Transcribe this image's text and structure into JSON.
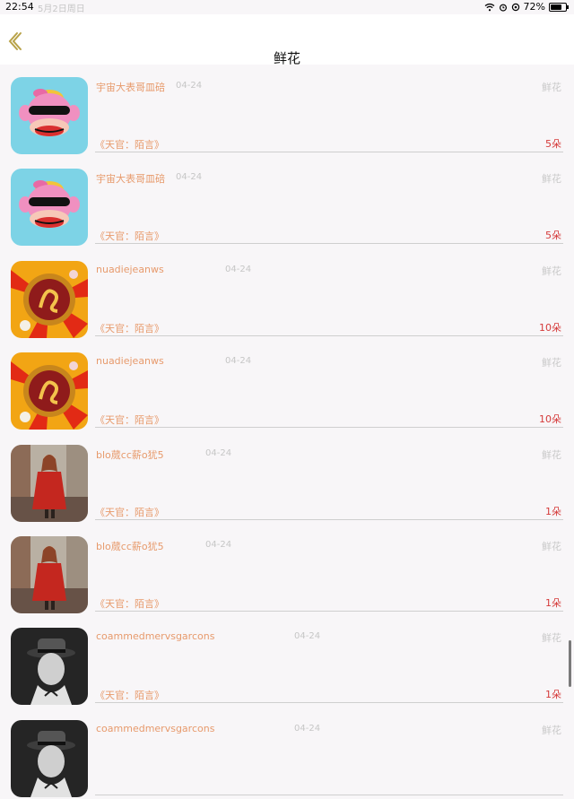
{
  "status_bar": {
    "time": "22:54",
    "date": "5月2日周日",
    "battery": "72%",
    "battery_level": 0.72
  },
  "nav": {
    "title": "鲜花",
    "back_icon": "chevron-left-icon"
  },
  "rows": [
    {
      "user": "宇宙大表哥皿碚",
      "date": "04-24",
      "type": "鲜花",
      "work": "《天官：陌言》",
      "qty": "5朵",
      "avatar": "monkey"
    },
    {
      "user": "宇宙大表哥皿碚",
      "date": "04-24",
      "type": "鲜花",
      "work": "《天官：陌言》",
      "qty": "5朵",
      "avatar": "monkey"
    },
    {
      "user": "nuadiejeanws",
      "date": "04-24",
      "type": "鲜花",
      "work": "《天官：陌言》",
      "qty": "10朵",
      "avatar": "medallion"
    },
    {
      "user": "nuadiejeanws",
      "date": "04-24",
      "type": "鲜花",
      "work": "《天官：陌言》",
      "qty": "10朵",
      "avatar": "medallion"
    },
    {
      "user": "blo蒇cc薪o犹5",
      "date": "04-24",
      "type": "鲜花",
      "work": "《天官：陌言》",
      "qty": "1朵",
      "avatar": "redcoat"
    },
    {
      "user": "blo蒇cc薪o犹5",
      "date": "04-24",
      "type": "鲜花",
      "work": "《天官：陌言》",
      "qty": "1朵",
      "avatar": "redcoat"
    },
    {
      "user": "coammedmervsgarcons",
      "date": "04-24",
      "type": "鲜花",
      "work": "《天官：陌言》",
      "qty": "1朵",
      "avatar": "hatman"
    },
    {
      "user": "coammedmervsgarcons",
      "date": "04-24",
      "type": "鲜花",
      "work": "",
      "qty": "",
      "avatar": "hatman"
    }
  ]
}
